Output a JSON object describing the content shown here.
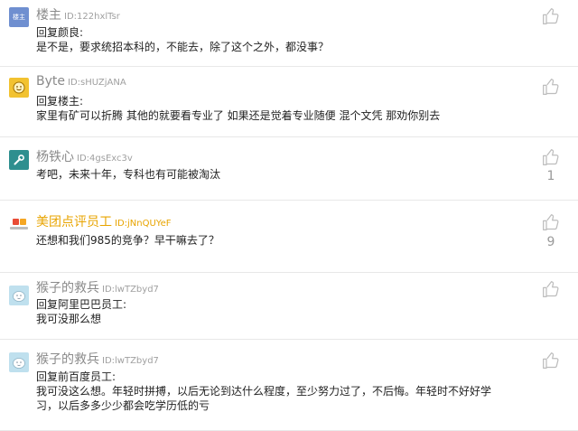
{
  "colors": {
    "name": "#8a8a8a",
    "vip_name": "#e8a400",
    "divider": "#e8e8e8",
    "like_icon": "#bdbdbd"
  },
  "comments": [
    {
      "avatar_icon": "building-owner-badge-icon",
      "avatar_text": "楼主",
      "name": "楼主",
      "id": "ID:122hxlTsr",
      "lines": [
        "回复颜良:",
        "是不是，要求统招本科的，不能去，除了这个之外，都没事？"
      ],
      "likes": ""
    },
    {
      "avatar_icon": "smiley-face-icon",
      "name": "Byte",
      "id": "ID:sHUZjANA",
      "lines": [
        "回复楼主:",
        "家里有矿可以折腾 其他的就要看专业了 如果还是觉着专业随便 混个文凭 那劝你别去"
      ],
      "likes": ""
    },
    {
      "avatar_icon": "wrench-icon",
      "name": "杨铁心",
      "id": "ID:4gsExc3v",
      "lines": [
        "考吧，未来十年，专科也有可能被淘汰"
      ],
      "likes": "1"
    },
    {
      "avatar_icon": "meituan-dianping-logo-icon",
      "name": "美团点评员工",
      "id": "ID:jNnQUYeF",
      "lines": [
        "还想和我们985的竞争？早干嘛去了？"
      ],
      "likes": "9"
    },
    {
      "avatar_icon": "monkey-avatar-icon",
      "name": "猴子的救兵",
      "id": "ID:lwTZbyd7",
      "lines": [
        "回复阿里巴巴员工:",
        "我可没那么想"
      ],
      "likes": ""
    },
    {
      "avatar_icon": "monkey-avatar-icon",
      "name": "猴子的救兵",
      "id": "ID:lwTZbyd7",
      "lines": [
        "回复前百度员工:",
        "我可没这么想。年轻时拼搏，以后无论到达什么程度，至少努力过了，不后悔。年轻时不好好学",
        "习，以后多多少少都会吃学历低的亏"
      ],
      "likes": ""
    }
  ]
}
